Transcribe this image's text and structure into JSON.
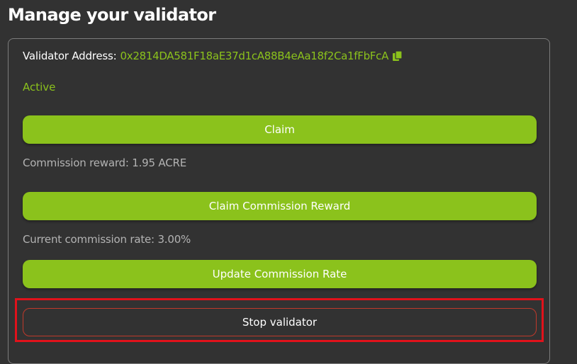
{
  "header": {
    "title": "Manage your validator"
  },
  "validator": {
    "address_label": "Validator Address:",
    "address_value": "0x2814DA581F18aE37d1cA88B4eAa18f2Ca1fFbFcA",
    "status": "Active"
  },
  "actions": {
    "claim_label": "Claim",
    "commission_reward_text": "Commission reward: 1.95 ACRE",
    "claim_commission_label": "Claim Commission Reward",
    "commission_rate_text": "Current commission rate: 3.00%",
    "update_commission_label": "Update Commission Rate",
    "stop_validator_label": "Stop validator"
  },
  "icons": {
    "copy": "copy-icon"
  },
  "colors": {
    "background": "#323232",
    "accent": "#8bc21c",
    "muted_text": "#b3b3b3",
    "highlight": "#e1121b",
    "stop_border": "#c0392b"
  }
}
